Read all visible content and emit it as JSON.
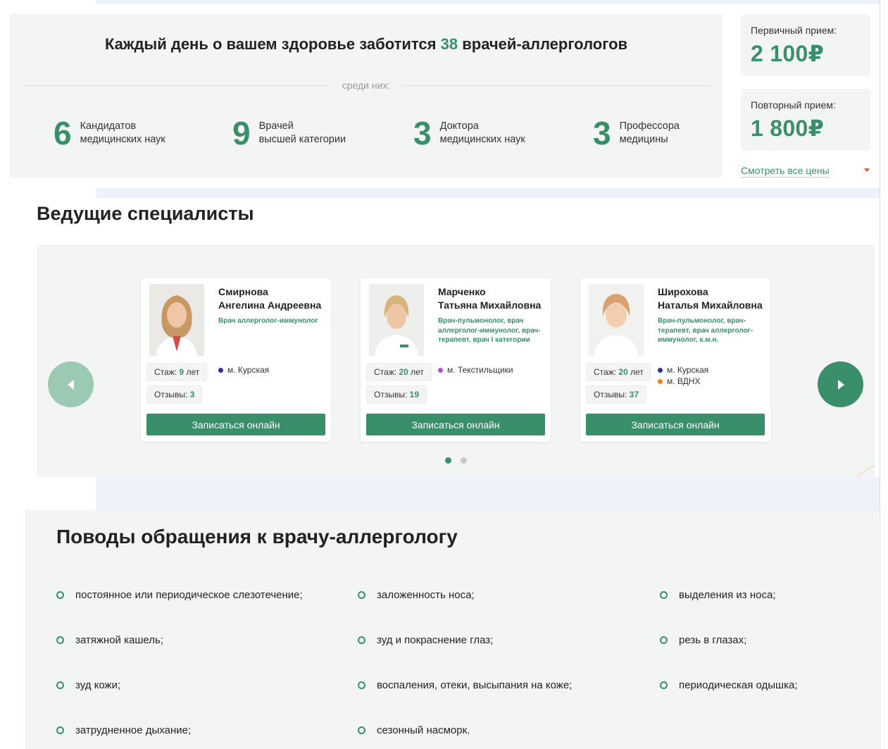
{
  "stats": {
    "title_prefix": "Каждый день о вашем здоровье заботится",
    "title_number": "38",
    "title_suffix": "врачей-аллергологов",
    "among_label": "среди них:",
    "items": [
      {
        "num": "6",
        "line1": "Кандидатов",
        "line2": "медицинских наук"
      },
      {
        "num": "9",
        "line1": "Врачей",
        "line2": "высшей категории"
      },
      {
        "num": "3",
        "line1": "Доктора",
        "line2": "медицинских наук"
      },
      {
        "num": "3",
        "line1": "Профессора",
        "line2": "медицины"
      }
    ]
  },
  "prices": {
    "primary_label": "Первичный прием:",
    "primary_value": "2 100₽",
    "repeat_label": "Повторный прием:",
    "repeat_value": "1 800₽",
    "all_prices_link": "Смотреть все цены"
  },
  "specialists": {
    "title": "Ведущие специалисты",
    "experience_label": "Стаж:",
    "reviews_label": "Отзывы:",
    "book_label": "Записаться онлайн",
    "doctors": [
      {
        "surname": "Смирнова",
        "given": "Ангелина Андреевна",
        "specialty": "Врач аллерголог-иммунолог",
        "experience_years": "9",
        "experience_unit": "лет",
        "reviews": "3",
        "metro": [
          {
            "name": "м. Курская",
            "color": "#2e3192"
          }
        ]
      },
      {
        "surname": "Марченко",
        "given": "Татьяна Михайловна",
        "specialty": "Врач-пульмонолог, врач аллерголог-иммунолог, врач-терапевт, врач I категории",
        "experience_years": "20",
        "experience_unit": "лет",
        "reviews": "19",
        "metro": [
          {
            "name": "м. Текстильщики",
            "color": "#b34fc9"
          }
        ]
      },
      {
        "surname": "Широхова",
        "given": "Наталья Михайловна",
        "specialty": "Врач-пульмонолог, врач-терапевт, врач аллерголог-иммунолог, к.м.н.",
        "experience_years": "20",
        "experience_unit": "лет",
        "reviews": "37",
        "metro": [
          {
            "name": "м. Курская",
            "color": "#2e3192"
          },
          {
            "name": "м. ВДНХ",
            "color": "#f58220"
          }
        ]
      }
    ]
  },
  "reasons": {
    "title": "Поводы обращения к врачу-аллергологу",
    "items": [
      "постоянное или периодическое слезотечение;",
      "заложенность носа;",
      "выделения из носа;",
      "затяжной кашель;",
      "зуд и покраснение глаз;",
      "резь в глазах;",
      "зуд кожи;",
      "воспаления, отеки, высыпания на коже;",
      "периодическая одышка;",
      "затрудненное дыхание;",
      "сезонный насморк."
    ]
  },
  "colors": {
    "accent": "#3a8f6b",
    "accent_light": "#9bc9b1",
    "panel_bg": "#f3f5f4",
    "caret": "#e5533d"
  }
}
